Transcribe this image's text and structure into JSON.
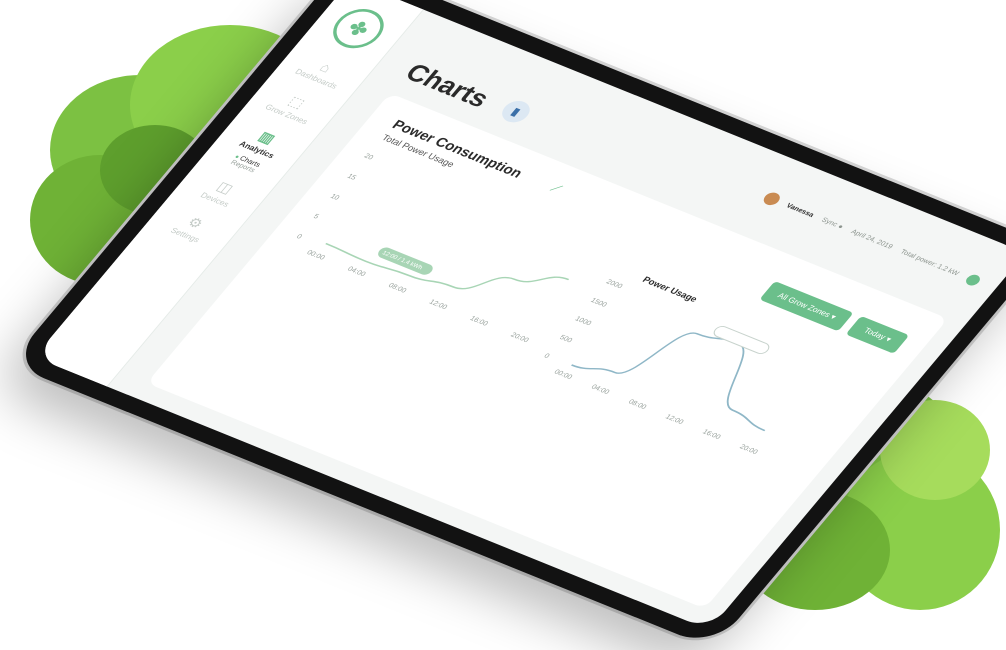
{
  "colors": {
    "accent": "#6bbf8b",
    "chart_line": "#a8d5b5",
    "chart_line2": "#8fb7c7",
    "background": "#f4f6f5"
  },
  "sidebar": {
    "logo_icon": "leaf-logo-icon",
    "items": [
      {
        "label": "Dashboards",
        "icon": "home-icon",
        "active": false
      },
      {
        "label": "Grow Zones",
        "icon": "zones-icon",
        "active": false
      },
      {
        "label": "Analytics",
        "icon": "analytics-icon",
        "active": true
      },
      {
        "label": "Devices",
        "icon": "devices-icon",
        "active": false
      },
      {
        "label": "Settings",
        "icon": "settings-icon",
        "active": false
      }
    ],
    "subnav": [
      "Charts",
      "Reports"
    ]
  },
  "header": {
    "title": "Charts",
    "title_icon": "bar-chart-icon",
    "user_name": "Vanessa",
    "info": [
      "Sync ●",
      "April 24, 2019",
      "Total power: 1.2 kW"
    ]
  },
  "card": {
    "title": "Power Consumption",
    "subtitle": "Total Power Usage",
    "filters": [
      "All Grow Zones",
      "Today"
    ]
  },
  "chart_data": [
    {
      "type": "line",
      "title": "",
      "x": [
        "00:00",
        "04:00",
        "08:00",
        "12:00",
        "16:00",
        "20:00"
      ],
      "y_ticks": [
        "20",
        "15",
        "10",
        "5",
        "0"
      ],
      "values": [
        0.5,
        0.2,
        0.8,
        2,
        8,
        12
      ],
      "ylim": [
        0,
        20
      ],
      "annotation": "12:00 / 1.4 kWh"
    },
    {
      "type": "line",
      "title": "Power Usage",
      "x": [
        "00:00",
        "04:00",
        "08:00",
        "12:00",
        "16:00",
        "20:00"
      ],
      "y_ticks": [
        "2000",
        "1500",
        "1000",
        "500",
        "0"
      ],
      "values": [
        0,
        200,
        1650,
        1800,
        400,
        250
      ],
      "ylim": [
        0,
        2000
      ]
    }
  ]
}
